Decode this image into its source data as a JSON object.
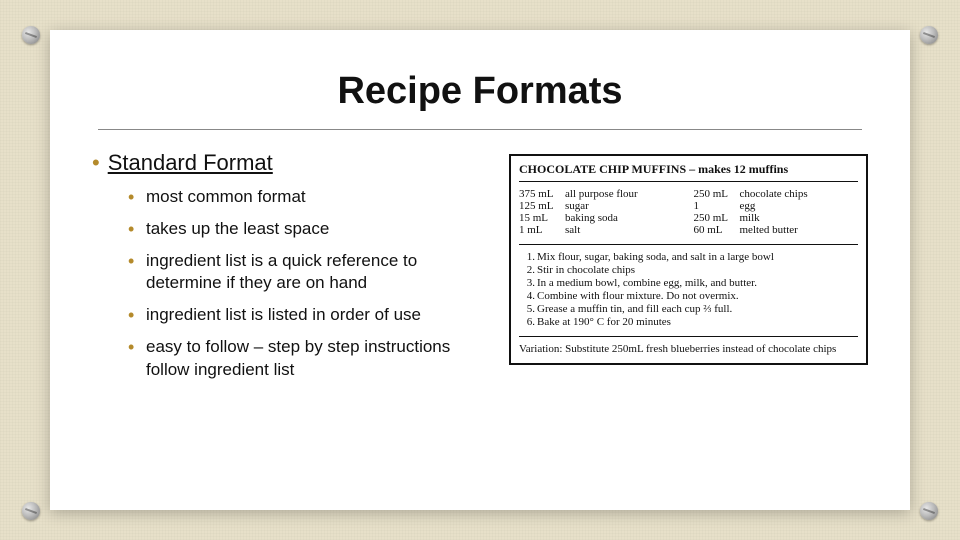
{
  "title": "Recipe Formats",
  "topic": "Standard Format",
  "bullets": [
    "most common format",
    "takes up the least space",
    "ingredient list is a quick reference to determine if they are on hand",
    "ingredient list is listed in order of use",
    "easy to follow – step by step instructions follow ingredient list"
  ],
  "recipe": {
    "header": "CHOCOLATE CHIP MUFFINS – makes 12 muffins",
    "ingredients_a": [
      {
        "amt": "375 mL",
        "name": "all purpose flour"
      },
      {
        "amt": "125 mL",
        "name": "sugar"
      },
      {
        "amt": "15 mL",
        "name": "baking soda"
      },
      {
        "amt": "1 mL",
        "name": "salt"
      }
    ],
    "ingredients_b": [
      {
        "amt": "250 mL",
        "name": "chocolate chips"
      },
      {
        "amt": "1",
        "name": "egg"
      },
      {
        "amt": "250 mL",
        "name": "milk"
      },
      {
        "amt": "60 mL",
        "name": "melted butter"
      }
    ],
    "steps": [
      "Mix flour, sugar, baking soda, and salt in a large bowl",
      "Stir in chocolate chips",
      "In a medium bowl, combine egg, milk, and butter.",
      "Combine with flour mixture. Do not overmix.",
      "Grease a muffin tin, and fill each cup ⅔ full.",
      "Bake at 190° C for 20 minutes"
    ],
    "variation": "Variation: Substitute 250mL fresh blueberries instead of chocolate chips"
  }
}
